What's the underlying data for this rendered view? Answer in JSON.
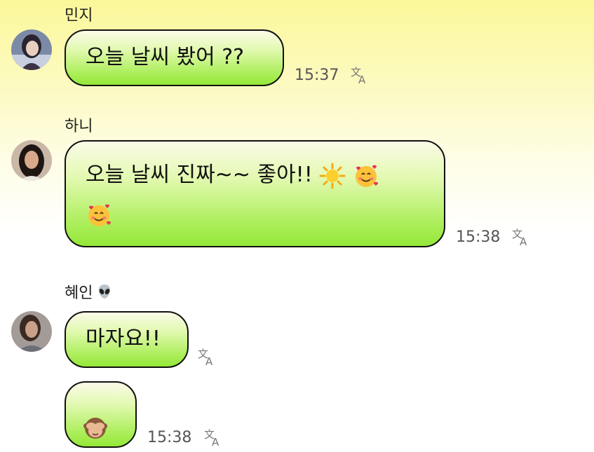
{
  "messages": [
    {
      "sender": "민지",
      "text": "오늘 날씨 봤어 ??",
      "time": "15:37"
    },
    {
      "sender": "하니",
      "text": "오늘 날씨 진짜~~ 좋아!!",
      "emojis": [
        "sun-emoji",
        "smiling-face-with-hearts-emoji",
        "smiling-face-with-hearts-emoji"
      ],
      "time": "15:38"
    },
    {
      "sender": "혜인",
      "sender_emoji": "alien-emoji",
      "text": "마자요!!",
      "time": ""
    },
    {
      "sender": "혜인",
      "emojis": [
        "see-no-evil-monkey-emoji"
      ],
      "time": "15:38"
    }
  ],
  "icons": {
    "translate": "translate-icon"
  },
  "colors": {
    "bubble_top": "#fbfbe8",
    "bubble_bottom": "#94e838",
    "bubble_border": "#111111",
    "bg_top": "#fbf89a",
    "time_text": "#555555"
  }
}
